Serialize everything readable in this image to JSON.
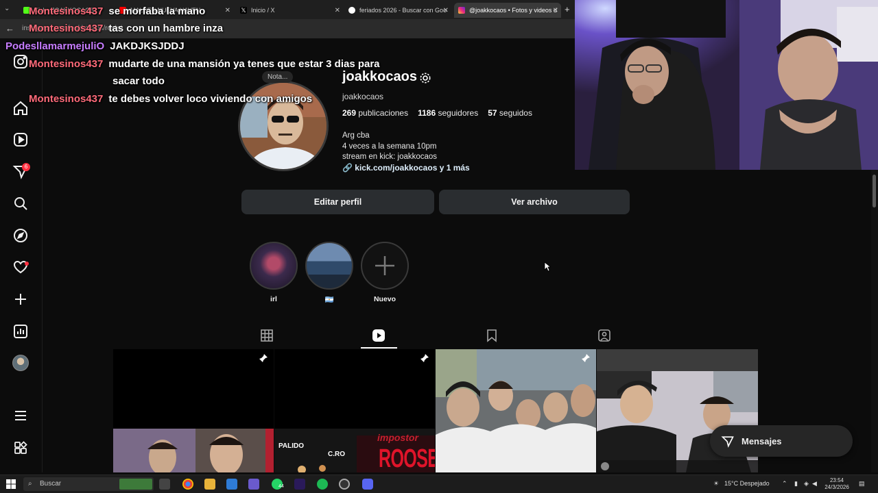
{
  "browser": {
    "tabs": [
      {
        "title": "Kick • JOAKKOCAOS",
        "active": false
      },
      {
        "title": "MALBEN NUEVA HAVEN",
        "active": false
      },
      {
        "title": "Inicio / X",
        "active": false
      },
      {
        "title": "feriados 2026 - Buscar con Goo",
        "active": false
      },
      {
        "title": "@joakkocaos • Fotos y videos d",
        "active": true
      }
    ],
    "new_tab_label": "+",
    "url": "instagram.com/joakkocaos/reels/"
  },
  "chat": [
    {
      "user": "Montesinos437",
      "message": "se morfaba la mano",
      "color": "#ff6b7a"
    },
    {
      "user": "Montesinos437",
      "message": "tas con un hambre inza",
      "color": "#ff6b7a"
    },
    {
      "user": "PodesllamarmejuliO",
      "message": "JAKDJKSJDDJ",
      "color": "#c77dff"
    },
    {
      "user": "Montesinos437",
      "message": "mudarte de una mansión ya tenes que estar 3 dias para",
      "message2": "sacar todo",
      "color": "#ff6b7a"
    },
    {
      "user": "Montesinos437",
      "message": "te debes volver loco viviendo con amigos",
      "color": "#ff6b7a"
    }
  ],
  "profile": {
    "note": "Nota...",
    "username": "joakkocaos",
    "handle": "joakkocaos",
    "stats": {
      "posts_count": "269",
      "posts_label": "publicaciones",
      "followers_count": "1186",
      "followers_label": "seguidores",
      "following_count": "57",
      "following_label": "seguidos"
    },
    "bio": [
      "Arg cba",
      "4 veces a la semana 10pm",
      "stream en kick: joakkocaos"
    ],
    "link": "kick.com/joakkocaos y 1 más",
    "edit_button": "Editar perfil",
    "archive_button": "Ver archivo"
  },
  "highlights": [
    {
      "label": "irl"
    },
    {
      "label": "🇦🇷"
    },
    {
      "label": "Nuevo"
    }
  ],
  "grid_overlays": {
    "palido": "PALIDO",
    "cro": "C.RO",
    "impostor": "impostor",
    "roosevelt": "ROOSEVELT"
  },
  "messages_button": "Mensajes",
  "taskbar": {
    "search_placeholder": "Buscar",
    "weather": "15°C  Despejado",
    "time": "23:54",
    "date": "24/3/2026",
    "whatsapp_badge": "44"
  },
  "colors": {
    "background": "#0c0c0c",
    "button": "#2a2d30",
    "badge": "#ff3040",
    "chat_user_red": "#ff6b7a",
    "chat_user_purple": "#c77dff"
  }
}
